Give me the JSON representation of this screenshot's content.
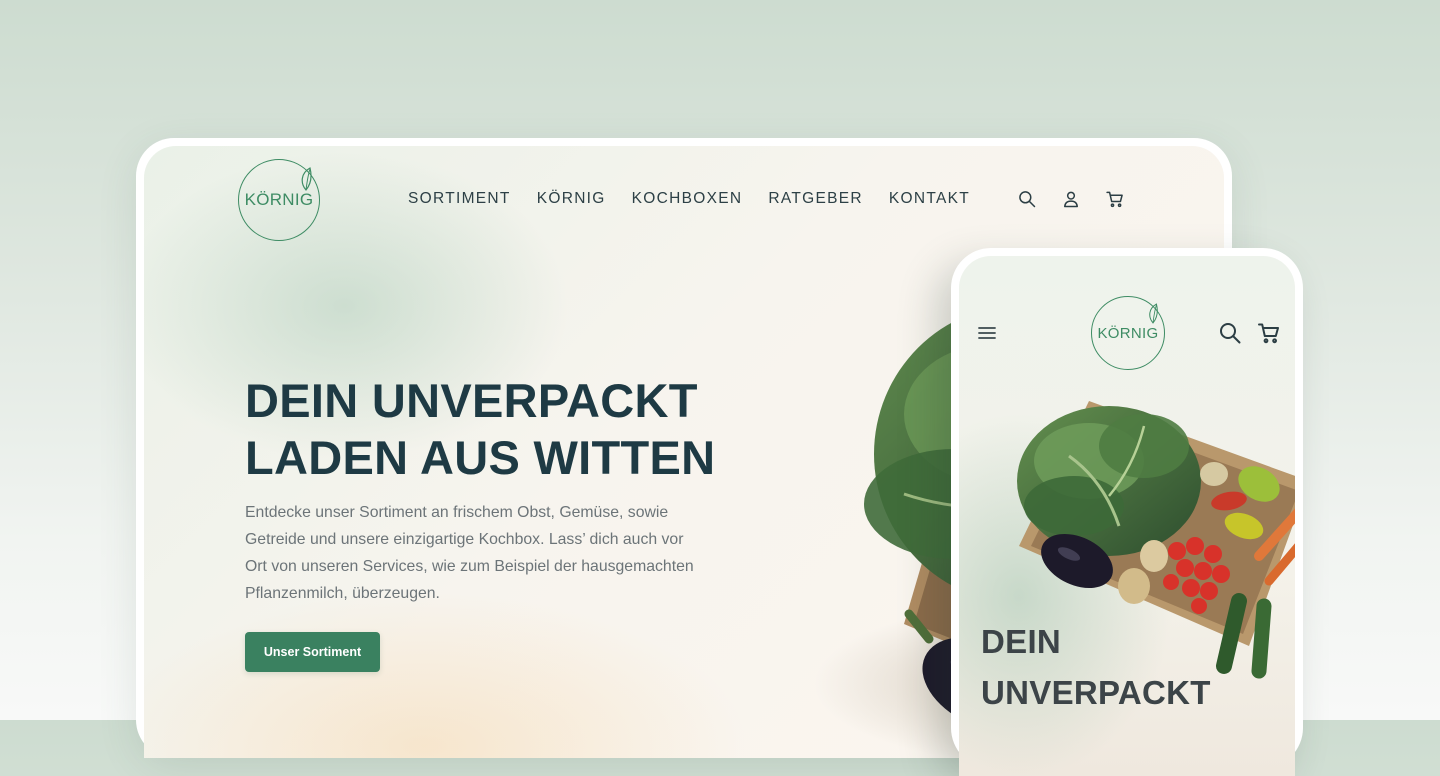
{
  "brand": {
    "logo_text": "KÖRNIG",
    "accent_color": "#3a8160",
    "logo_color": "#3e8c64"
  },
  "desktop": {
    "nav": [
      {
        "label": "SORTIMENT"
      },
      {
        "label": "KÖRNIG"
      },
      {
        "label": "KOCHBOXEN"
      },
      {
        "label": "RATGEBER"
      },
      {
        "label": "KONTAKT"
      }
    ],
    "header_icons": [
      "search-icon",
      "user-icon",
      "cart-icon"
    ],
    "hero": {
      "title_line1": "DEIN UNVERPACKT",
      "title_line2": "LADEN AUS WITTEN",
      "text": "Entdecke unser Sortiment an frischem Obst, Gemüse, sowie Getreide und unsere einzigartige Kochbox. Lass’ dich auch vor Ort von unseren Services, wie zum Beispiel der hausgemachten Pflanzenmilch, überzeugen.",
      "cta_label": "Unser Sortiment"
    }
  },
  "mobile": {
    "header_icons": [
      "menu-icon",
      "search-icon",
      "cart-icon"
    ],
    "hero": {
      "title_line1": "DEIN",
      "title_line2": "UNVERPACKT"
    }
  }
}
